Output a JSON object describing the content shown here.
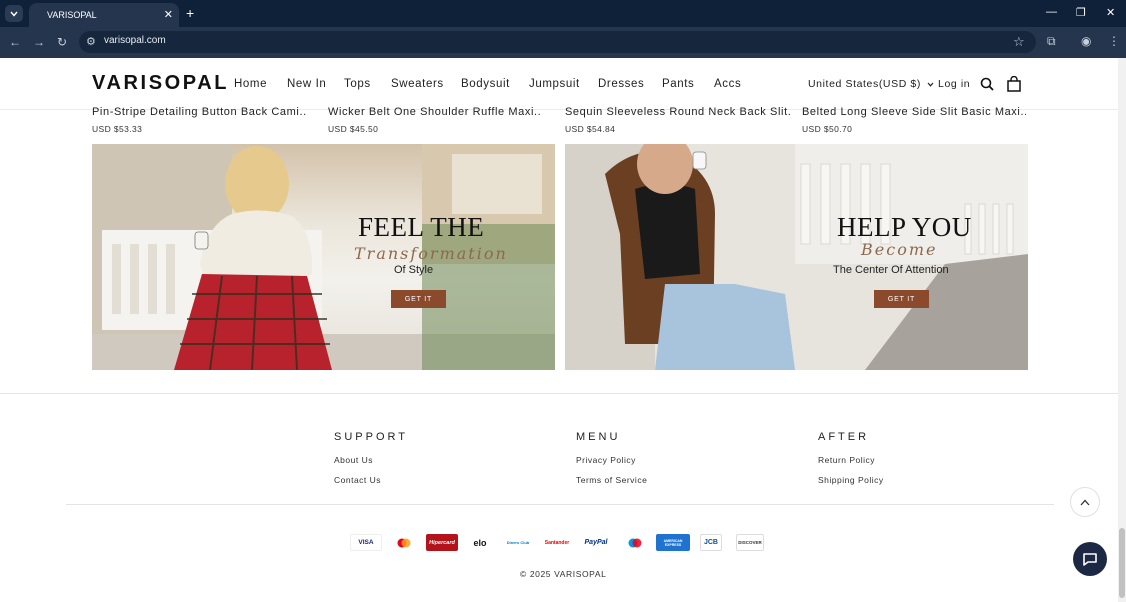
{
  "browser": {
    "tab_title": "VARISOPAL",
    "url": "varisopal.com"
  },
  "header": {
    "logo": "VARISOPAL",
    "nav": [
      "Home",
      "New In",
      "Tops",
      "Sweaters",
      "Bodysuit",
      "Jumpsuit",
      "Dresses",
      "Pants",
      "Accs"
    ],
    "currency": "United States(USD $)",
    "login": "Log in"
  },
  "products": [
    {
      "title": "Pin-Stripe Detailing Button Back Cami...",
      "price": "USD $53.33"
    },
    {
      "title": "Wicker Belt One Shoulder Ruffle Maxi...",
      "price": "USD $45.50"
    },
    {
      "title": "Sequin Sleeveless Round Neck Back Slit...",
      "price": "USD $54.84"
    },
    {
      "title": "Belted Long Sleeve Side Slit Basic Maxi...",
      "price": "USD $50.70"
    }
  ],
  "banners": [
    {
      "title": "FEEL THE",
      "script": "Transformation",
      "subtitle": "Of Style",
      "button": "GET IT"
    },
    {
      "title": "HELP YOU",
      "script": "Become",
      "subtitle": "The Center Of Attention",
      "button": "GET IT"
    }
  ],
  "footer": {
    "columns": [
      {
        "heading": "SUPPORT",
        "links": [
          "About Us",
          "Contact Us"
        ]
      },
      {
        "heading": "MENU",
        "links": [
          "Privacy Policy",
          "Terms of Service"
        ]
      },
      {
        "heading": "AFTER",
        "links": [
          "Return Policy",
          "Shipping Policy"
        ]
      }
    ],
    "payments": [
      "VISA",
      "mastercard",
      "Hipercard",
      "elo",
      "Diners Club",
      "Santander",
      "PayPal",
      "maestro",
      "AMERICAN EXPRESS",
      "JCB",
      "DISCOVER"
    ],
    "copyright": "© 2025 VARISOPAL"
  },
  "colors": {
    "browser_dark": "#0f2138",
    "browser_toolbar": "#25354d",
    "banner_button": "#8b4a2b",
    "chat_button": "#1d2844"
  }
}
